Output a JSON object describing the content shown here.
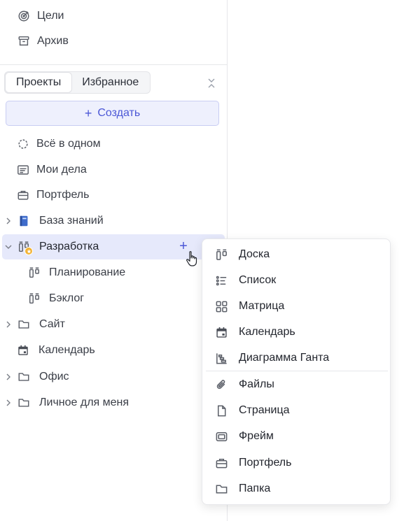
{
  "sidebar": {
    "top_items": [
      {
        "label": "Цели",
        "icon": "target-icon"
      },
      {
        "label": "Архив",
        "icon": "archive-icon"
      }
    ],
    "tabs": [
      {
        "label": "Проекты",
        "active": true
      },
      {
        "label": "Избранное",
        "active": false
      }
    ],
    "create_label": "Создать",
    "items": [
      {
        "label": "Всё в одном",
        "icon": "all-in-one-icon"
      },
      {
        "label": "Мои дела",
        "icon": "my-tasks-icon"
      },
      {
        "label": "Портфель",
        "icon": "briefcase-icon"
      },
      {
        "label": "База знаний",
        "icon": "book-icon"
      },
      {
        "label": "Разработка",
        "icon": "board-icon"
      },
      {
        "label": "Планирование",
        "icon": "board-icon"
      },
      {
        "label": "Бэклог",
        "icon": "board-icon"
      },
      {
        "label": "Сайт",
        "icon": "folder-icon"
      },
      {
        "label": "Календарь",
        "icon": "calendar-icon"
      },
      {
        "label": "Офис",
        "icon": "folder-icon"
      },
      {
        "label": "Личное для меня",
        "icon": "folder-icon"
      }
    ],
    "add_label": "+"
  },
  "menu": {
    "items": [
      {
        "label": "Доска",
        "icon": "board-icon"
      },
      {
        "label": "Список",
        "icon": "list-icon"
      },
      {
        "label": "Матрица",
        "icon": "matrix-icon"
      },
      {
        "label": "Календарь",
        "icon": "calendar-icon"
      },
      {
        "label": "Диаграмма Ганта",
        "icon": "gantt-icon"
      },
      {
        "label": "Файлы",
        "icon": "paperclip-icon"
      },
      {
        "label": "Страница",
        "icon": "page-icon"
      },
      {
        "label": "Фрейм",
        "icon": "frame-icon"
      },
      {
        "label": "Портфель",
        "icon": "briefcase-icon"
      },
      {
        "label": "Папка",
        "icon": "folder-icon"
      }
    ]
  },
  "colors": {
    "accent": "#4b57d6",
    "active_bg": "#e6e9fb",
    "favorite_badge": "#f2b233"
  }
}
